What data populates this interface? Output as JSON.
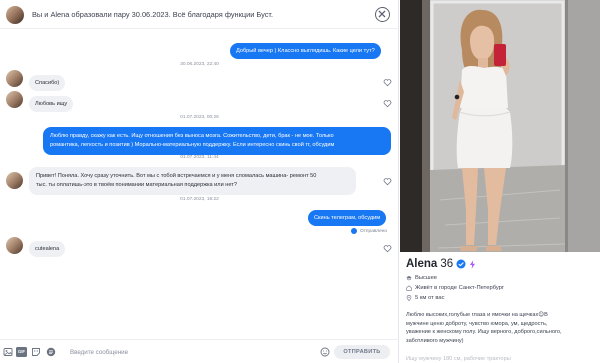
{
  "header": {
    "match_text": "Вы и Alena образовали пару 30.06.2023. Всё благодаря функции Буст.",
    "close_icon": "close-circle-icon"
  },
  "messages": {
    "m1": {
      "text": "Добрый вечер ) Классно выглядишь. Какие цели тут?"
    },
    "t1": "30.06.2023, 22:40",
    "m2": {
      "text": "Спасибо)"
    },
    "m3": {
      "text": "Любовь ищу"
    },
    "t2": "01.07.2023, 00:26",
    "m4": {
      "lines": [
        "Люблю правду, скажу как есть. Ищу отношения без выноса мозга. Сожительство, дети, брак - не мое. Только",
        "романтика, легкость и позитив ) Морально-материальную поддержку. Если интересно скинь свой тг, обсудим"
      ]
    },
    "t3": "01.07.2023, 11:44",
    "m5": {
      "lines": [
        "Привет! Поняла. Хочу сразу уточнить. Вот мы с тобой встречаемся и у меня сломалась машина- ремонт 50",
        "тыс. ты оплатишь-это в твоём понимании материальная поддержка или нет?"
      ]
    },
    "t4": "01.07.2023, 16:22",
    "m6": {
      "text": "Скинь телеграм, обсудим"
    },
    "status": "Отправлено",
    "m7": {
      "text": "cutealena"
    }
  },
  "composer": {
    "placeholder": "Введите сообщение",
    "send_label": "ОТПРАВИТЬ",
    "gif_label": "GIF"
  },
  "profile": {
    "name": "Alena",
    "age": "36",
    "education": "Высшее",
    "city": "Живёт в городе Санкт-Петербург",
    "distance": "5 км от вас",
    "bio_lines": [
      "Люблю высоких,голубые глаза и ямочки на щечках😊В",
      "мужчине ценю доброту, чувство юмора, ум, щедрость,",
      "уважение к женскому полу. Ищу верного, доброго,сильного,",
      "заботливого мужчину)"
    ],
    "bio_faded": "Ищу мужчину 180 см, рабочие тракторы"
  },
  "colors": {
    "accent": "#1877f2",
    "incoming_bubble": "#eef0f3",
    "boost": "#a855f7"
  }
}
